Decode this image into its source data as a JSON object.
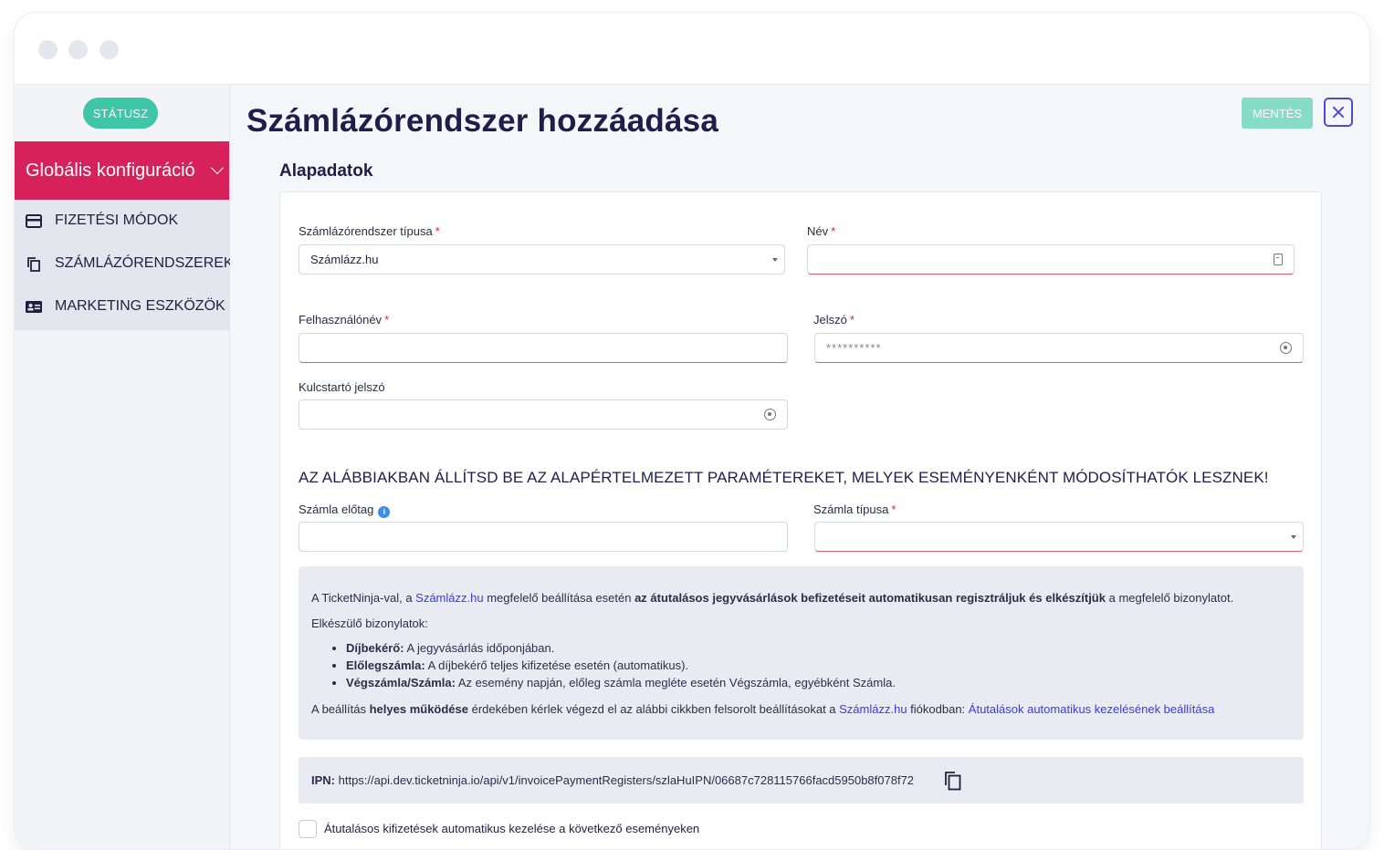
{
  "sidebar": {
    "status_label": "STÁTUSZ",
    "active_item": "Globális konfiguráció",
    "items": [
      {
        "label": "FIZETÉSI MÓDOK",
        "icon": "credit-card-icon"
      },
      {
        "label": "SZÁMLÁZÓRENDSZEREK",
        "icon": "copy-icon"
      },
      {
        "label": "MARKETING ESZKÖZÖK",
        "icon": "contact-card-icon"
      }
    ]
  },
  "header": {
    "title": "Számlázórendszer hozzáadása",
    "save_label": "MENTÉS"
  },
  "form": {
    "section_title": "Alapadatok",
    "type_label": "Számlázórendszer típusa",
    "type_value": "Számlázz.hu",
    "name_label": "Név",
    "username_label": "Felhasználónév",
    "password_label": "Jelszó",
    "password_value": "**********",
    "keychain_label": "Kulcstartó jelszó",
    "defaults_heading": "AZ ALÁBBIAKBAN ÁLLÍTSD BE AZ ALAPÉRTELMEZETT PARAMÉTEREKET, MELYEK ESEMÉNYENKÉNT MÓDOSÍTHATÓK LESZNEK!",
    "prefix_label": "Számla előtag",
    "invoice_type_label": "Számla típusa",
    "required_mark": "*"
  },
  "notice": {
    "line1_a": "A TicketNinja-val, a ",
    "line1_link": "Számlázz.hu",
    "line1_b": " megfelelő beállítása esetén ",
    "line1_bold": "az átutalásos jegyvásárlások befizetéseit automatikusan regisztráljuk és elkészítjük",
    "line1_c": " a megfelelő bizonylatot.",
    "line2": "Elkészülő bizonylatok:",
    "bullets": [
      {
        "bold": "Díjbekérő:",
        "text": " A jegyvásárlás időponjában."
      },
      {
        "bold": "Előlegszámla:",
        "text": " A díjbekérő teljes kifizetése esetén (automatikus)."
      },
      {
        "bold": "Végszámla/Számla:",
        "text": " Az esemény napján, előleg számla megléte esetén Végszámla, egyébként Számla."
      }
    ],
    "line3_a": "A beállítás ",
    "line3_bold": "helyes működése",
    "line3_b": " érdekében kérlek végezd el az alábbi cikkben felsorolt beállításokat a ",
    "line3_link1": "Számlázz.hu",
    "line3_c": " fiókodban: ",
    "line3_link2": "Átutalások automatikus kezelésének beállítása"
  },
  "ipn": {
    "label": "IPN:",
    "url": " https://api.dev.ticketninja.io/api/v1/invoicePaymentRegisters/szlaHuIPN/06687c728115766facd5950b8f078f72"
  },
  "auto_handle_label": "Átutalásos kifizetések automatikus kezelése a következő eseményeken",
  "colors": {
    "accent": "#d6215a",
    "status": "#3ec6a7",
    "link": "#3b3be0"
  }
}
